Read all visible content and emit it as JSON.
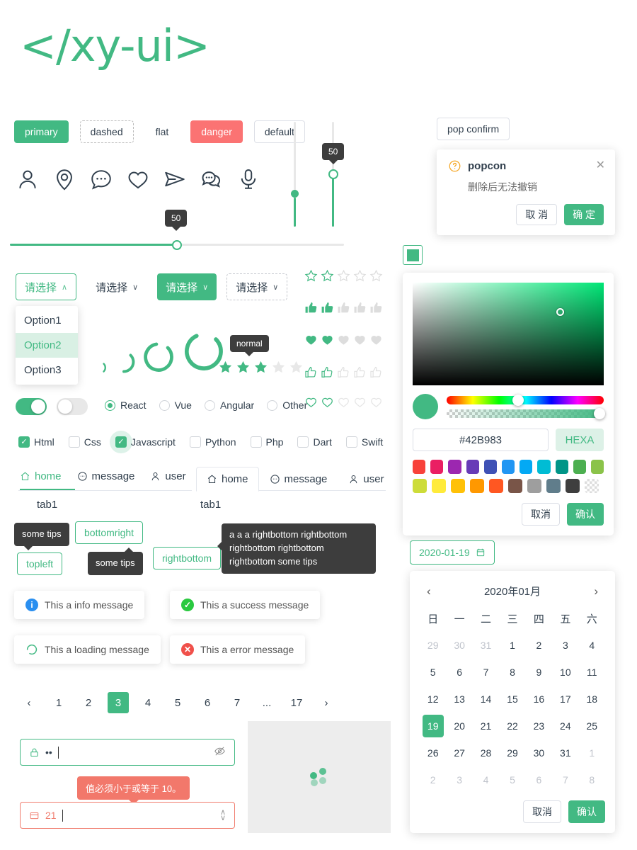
{
  "brand": {
    "logo": "</xy-ui>",
    "accent": "#42b983",
    "danger": "#fb7373",
    "dark": "#3d3d3d"
  },
  "buttons": [
    {
      "label": "primary",
      "style": "primary"
    },
    {
      "label": "dashed",
      "style": "dashed"
    },
    {
      "label": "flat",
      "style": "flat"
    },
    {
      "label": "danger",
      "style": "danger"
    },
    {
      "label": "default",
      "style": "default"
    }
  ],
  "icons": [
    "user-icon",
    "location-pin-icon",
    "comment-dots-icon",
    "heart-icon",
    "send-icon",
    "chat-bubbles-icon",
    "microphone-icon"
  ],
  "sliders": {
    "horizontal": {
      "value": "50",
      "percent": 50
    },
    "vertical_plain": {
      "percent": 28
    },
    "vertical_tip": {
      "value": "50",
      "percent": 50
    }
  },
  "selects": [
    {
      "label": "请选择",
      "caret": "∧",
      "style": "outline"
    },
    {
      "label": "请选择",
      "caret": "∨",
      "style": "plain"
    },
    {
      "label": "请选择",
      "caret": "∨",
      "style": "solid"
    },
    {
      "label": "请选择",
      "caret": "∨",
      "style": "dash"
    }
  ],
  "dropdown": {
    "options": [
      "Option1",
      "Option2",
      "Option3"
    ],
    "active_index": 1
  },
  "rate": {
    "star_outline": {
      "filled": 2,
      "total": 5
    },
    "thumb_solid": {
      "filled": 2,
      "total": 5
    },
    "heart_solid": {
      "filled": 2,
      "total": 5
    },
    "thumb_outline": {
      "filled": 2,
      "total": 5
    },
    "heart_outline": {
      "filled": 2,
      "total": 5
    },
    "star_solid": {
      "filled": 3,
      "total": 5,
      "tooltip": "normal"
    }
  },
  "switches": [
    {
      "on": true
    },
    {
      "on": false
    }
  ],
  "radios": {
    "options": [
      "React",
      "Vue",
      "Angular",
      "Other"
    ],
    "selected_index": 0
  },
  "checkboxes": [
    {
      "label": "Html",
      "checked": true,
      "halo": false
    },
    {
      "label": "Css",
      "checked": false,
      "halo": false
    },
    {
      "label": "Javascript",
      "checked": true,
      "halo": true
    },
    {
      "label": "Python",
      "checked": false,
      "halo": false
    },
    {
      "label": "Php",
      "checked": false,
      "halo": false
    },
    {
      "label": "Dart",
      "checked": false,
      "halo": false
    },
    {
      "label": "Swift",
      "checked": false,
      "halo": false
    }
  ],
  "tabs_line": {
    "items": [
      {
        "label": "home",
        "icon": "home-icon",
        "active": true
      },
      {
        "label": "message",
        "icon": "message-icon",
        "active": false
      },
      {
        "label": "user",
        "icon": "user-icon",
        "active": false
      }
    ],
    "content": "tab1"
  },
  "tabs_card": {
    "items": [
      {
        "label": "home",
        "icon": "home-icon",
        "active": true
      },
      {
        "label": "message",
        "icon": "message-icon",
        "active": false
      },
      {
        "label": "user",
        "icon": "user-icon",
        "active": false
      }
    ],
    "content": "tab1"
  },
  "tooltips": [
    {
      "trigger": "topleft",
      "tip": "some tips"
    },
    {
      "trigger": "bottomright",
      "tip": "some tips"
    },
    {
      "trigger": "rightbottom",
      "tip": "a a a rightbottom rightbottom rightbottom rightbottom rightbottom some tips"
    }
  ],
  "messages": [
    {
      "text": "This a info message",
      "type": "info",
      "glyph": "i",
      "color": "#2a8ff0"
    },
    {
      "text": "This a success message",
      "type": "success",
      "glyph": "✓",
      "color": "#2ac940"
    },
    {
      "text": "This a loading message",
      "type": "loading",
      "glyph": "",
      "color": "#42b983"
    },
    {
      "text": "This a error message",
      "type": "error",
      "glyph": "✕",
      "color": "#f0504a"
    }
  ],
  "pagination": {
    "prev": "‹",
    "next": "›",
    "pages": [
      "1",
      "2",
      "3",
      "4",
      "5",
      "6",
      "7",
      "...",
      "17"
    ],
    "active": "3"
  },
  "fields": {
    "password": {
      "value": "••",
      "icon": "lock-icon",
      "suffix_icon": "eye-off-icon",
      "state": "ok"
    },
    "number": {
      "value": "21",
      "icon": "card-icon",
      "state": "error",
      "error": "值必须小于或等于 10。"
    }
  },
  "loading_box": {
    "dots": 4
  },
  "popconfirm": {
    "trigger": "pop confirm",
    "title": "popcon",
    "body": "删除后无法撤销",
    "cancel": "取 消",
    "confirm": "确 定",
    "close": "✕",
    "icon": "question-circle-icon"
  },
  "colorpicker": {
    "current": "#42B983",
    "hex_value": "#42B983",
    "mode_label": "HEXA",
    "cancel": "取消",
    "confirm": "确认",
    "hue_percent": 42,
    "alpha_percent": 100,
    "sat_x_percent": 76,
    "sat_y_percent": 27,
    "swatches_row1": [
      "#f8423a",
      "#ea1f63",
      "#9c27b0",
      "#673bb7",
      "#3f51b5",
      "#2196f3",
      "#03a9f4",
      "#00bcd4",
      "#009587",
      "#4caf50",
      "#8bc34a"
    ],
    "swatches_row2": [
      "#cddc39",
      "#ffeb3b",
      "#ffc107",
      "#ff9800",
      "#ff5722",
      "#795548",
      "#9e9e9e",
      "#607d8b",
      "#3e3e3e",
      "transparent"
    ]
  },
  "datepicker": {
    "trigger_value": "2020-01-19",
    "trigger_icon": "calendar-icon",
    "title": "2020年01月",
    "prev": "‹",
    "next": "›",
    "weekdays": [
      "日",
      "一",
      "二",
      "三",
      "四",
      "五",
      "六"
    ],
    "weeks": [
      [
        {
          "d": "29",
          "m": 1
        },
        {
          "d": "30",
          "m": 1
        },
        {
          "d": "31",
          "m": 1
        },
        {
          "d": "1",
          "m": 0
        },
        {
          "d": "2",
          "m": 0
        },
        {
          "d": "3",
          "m": 0
        },
        {
          "d": "4",
          "m": 0
        }
      ],
      [
        {
          "d": "5",
          "m": 0
        },
        {
          "d": "6",
          "m": 0
        },
        {
          "d": "7",
          "m": 0
        },
        {
          "d": "8",
          "m": 0
        },
        {
          "d": "9",
          "m": 0
        },
        {
          "d": "10",
          "m": 0
        },
        {
          "d": "11",
          "m": 0
        }
      ],
      [
        {
          "d": "12",
          "m": 0
        },
        {
          "d": "13",
          "m": 0
        },
        {
          "d": "14",
          "m": 0
        },
        {
          "d": "15",
          "m": 0
        },
        {
          "d": "16",
          "m": 0
        },
        {
          "d": "17",
          "m": 0
        },
        {
          "d": "18",
          "m": 0
        }
      ],
      [
        {
          "d": "19",
          "m": 0,
          "s": 1
        },
        {
          "d": "20",
          "m": 0
        },
        {
          "d": "21",
          "m": 0
        },
        {
          "d": "22",
          "m": 0
        },
        {
          "d": "23",
          "m": 0
        },
        {
          "d": "24",
          "m": 0
        },
        {
          "d": "25",
          "m": 0
        }
      ],
      [
        {
          "d": "26",
          "m": 0
        },
        {
          "d": "27",
          "m": 0
        },
        {
          "d": "28",
          "m": 0
        },
        {
          "d": "29",
          "m": 0
        },
        {
          "d": "30",
          "m": 0
        },
        {
          "d": "31",
          "m": 0
        },
        {
          "d": "1",
          "m": 1
        }
      ],
      [
        {
          "d": "2",
          "m": 1
        },
        {
          "d": "3",
          "m": 1
        },
        {
          "d": "4",
          "m": 1
        },
        {
          "d": "5",
          "m": 1
        },
        {
          "d": "6",
          "m": 1
        },
        {
          "d": "7",
          "m": 1
        },
        {
          "d": "8",
          "m": 1
        }
      ]
    ],
    "cancel": "取消",
    "confirm": "确认"
  }
}
